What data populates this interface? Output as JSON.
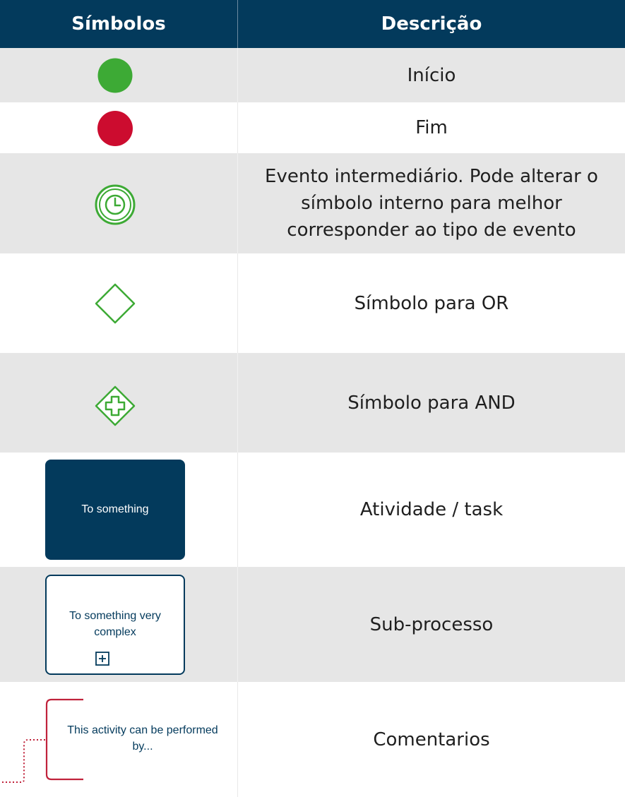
{
  "header": {
    "symbols_label": "Símbolos",
    "description_label": "Descrição"
  },
  "rows": [
    {
      "symbol": "green-filled-circle",
      "description": "Início"
    },
    {
      "symbol": "red-filled-circle",
      "description": "Fim"
    },
    {
      "symbol": "clock-intermediate-event",
      "description_lines": [
        "Evento intermediário. Pode alterar o",
        "símbolo interno para melhor",
        "corresponder ao tipo de evento"
      ]
    },
    {
      "symbol": "empty-diamond-gateway",
      "description": "Símbolo para OR"
    },
    {
      "symbol": "plus-diamond-gateway",
      "description": "Símbolo para AND"
    },
    {
      "symbol": "task-box",
      "symbol_text": "To something",
      "description": "Atividade / task"
    },
    {
      "symbol": "subprocess-box",
      "symbol_text_lines": [
        "To something very",
        "complex"
      ],
      "description": "Sub-processo"
    },
    {
      "symbol": "annotation-bracket",
      "symbol_text_lines": [
        "This activity can be performed",
        "by..."
      ],
      "description": "Comentarios"
    }
  ],
  "colors": {
    "header_bg": "#033a5c",
    "start_green": "#3daa35",
    "end_red": "#cc0c2f",
    "gateway_green": "#3daa35",
    "task_blue": "#033a5c",
    "annotation_red": "#c0223b",
    "row_gray": "#e6e6e6"
  }
}
